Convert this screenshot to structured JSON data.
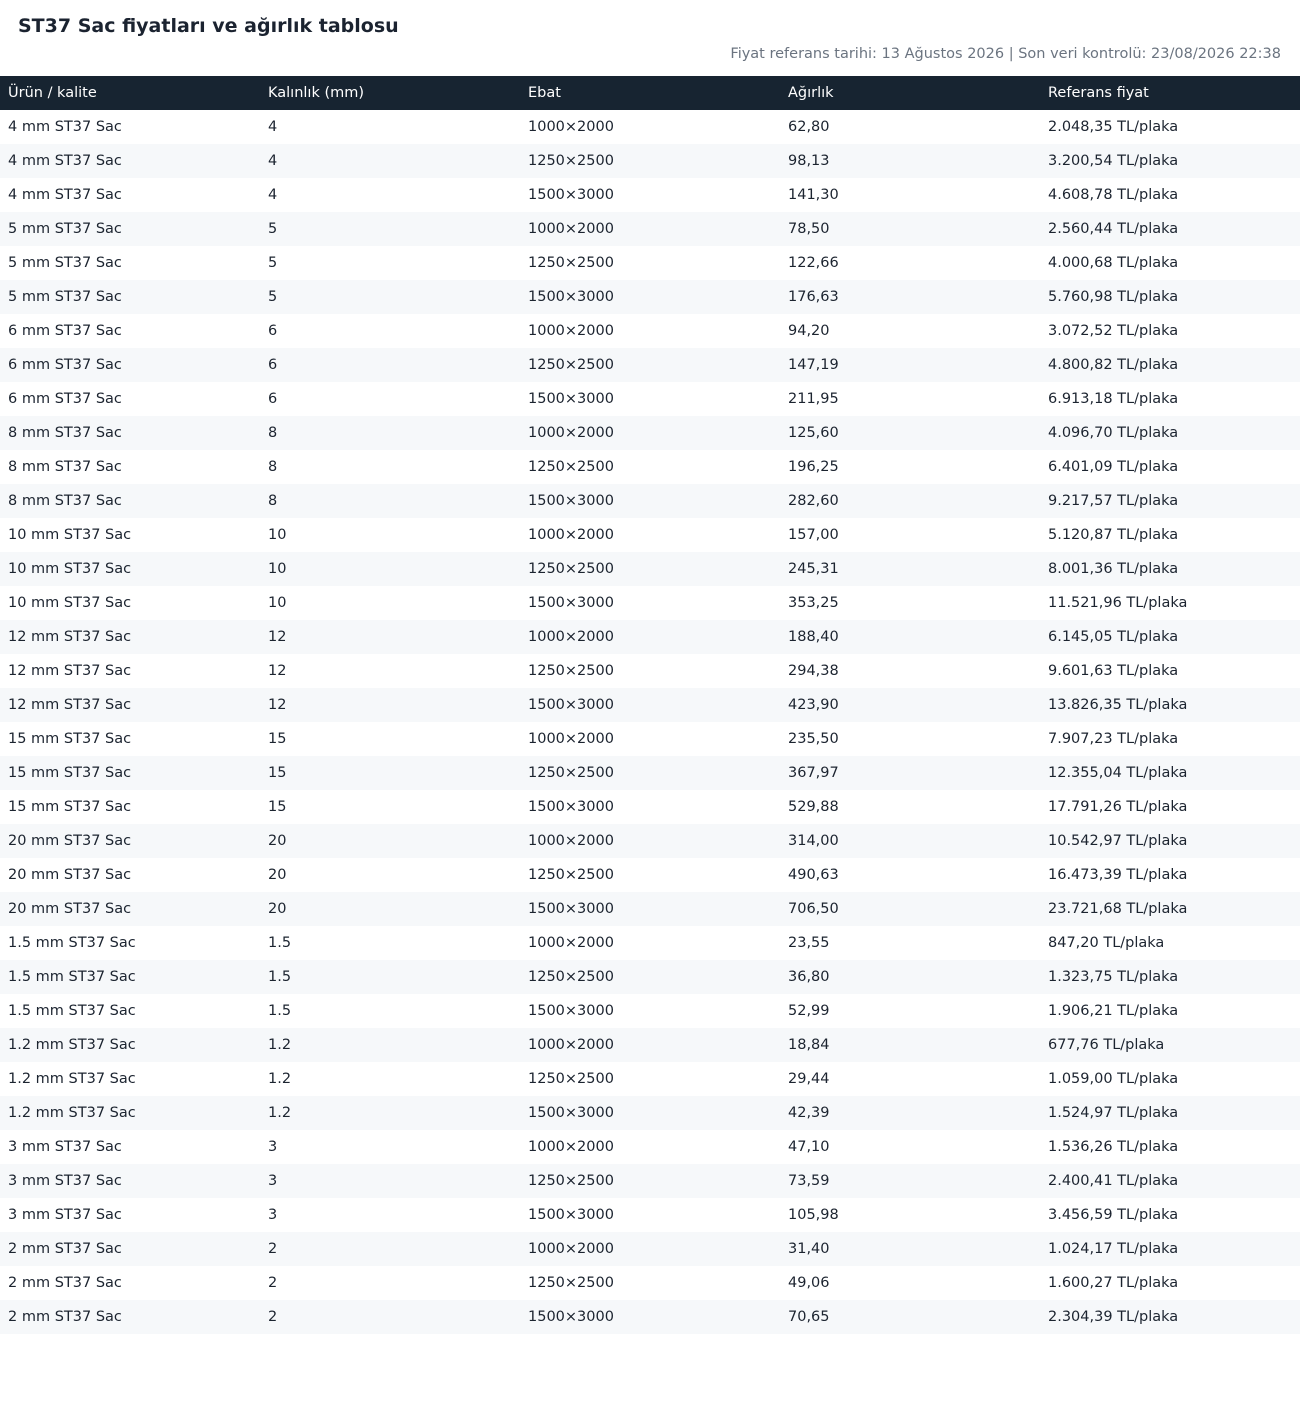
{
  "page": {
    "title": "ST37 Sac fiyatları ve ağırlık tablosu",
    "reference_line": "Fiyat referans tarihi: 13 Ağustos 2026 | Son veri kontrolü: 23/08/2026 22:38"
  },
  "table": {
    "headers": [
      "Ürün / kalite",
      "Kalınlık (mm)",
      "Ebat",
      "Ağırlık",
      "Referans fiyat"
    ],
    "rows": [
      [
        "4 mm ST37 Sac",
        "4",
        "1000×2000",
        "62,80",
        "2.048,35 TL/plaka"
      ],
      [
        "4 mm ST37 Sac",
        "4",
        "1250×2500",
        "98,13",
        "3.200,54 TL/plaka"
      ],
      [
        "4 mm ST37 Sac",
        "4",
        "1500×3000",
        "141,30",
        "4.608,78 TL/plaka"
      ],
      [
        "5 mm ST37 Sac",
        "5",
        "1000×2000",
        "78,50",
        "2.560,44 TL/plaka"
      ],
      [
        "5 mm ST37 Sac",
        "5",
        "1250×2500",
        "122,66",
        "4.000,68 TL/plaka"
      ],
      [
        "5 mm ST37 Sac",
        "5",
        "1500×3000",
        "176,63",
        "5.760,98 TL/plaka"
      ],
      [
        "6 mm ST37 Sac",
        "6",
        "1000×2000",
        "94,20",
        "3.072,52 TL/plaka"
      ],
      [
        "6 mm ST37 Sac",
        "6",
        "1250×2500",
        "147,19",
        "4.800,82 TL/plaka"
      ],
      [
        "6 mm ST37 Sac",
        "6",
        "1500×3000",
        "211,95",
        "6.913,18 TL/plaka"
      ],
      [
        "8 mm ST37 Sac",
        "8",
        "1000×2000",
        "125,60",
        "4.096,70 TL/plaka"
      ],
      [
        "8 mm ST37 Sac",
        "8",
        "1250×2500",
        "196,25",
        "6.401,09 TL/plaka"
      ],
      [
        "8 mm ST37 Sac",
        "8",
        "1500×3000",
        "282,60",
        "9.217,57 TL/plaka"
      ],
      [
        "10 mm ST37 Sac",
        "10",
        "1000×2000",
        "157,00",
        "5.120,87 TL/plaka"
      ],
      [
        "10 mm ST37 Sac",
        "10",
        "1250×2500",
        "245,31",
        "8.001,36 TL/plaka"
      ],
      [
        "10 mm ST37 Sac",
        "10",
        "1500×3000",
        "353,25",
        "11.521,96 TL/plaka"
      ],
      [
        "12 mm ST37 Sac",
        "12",
        "1000×2000",
        "188,40",
        "6.145,05 TL/plaka"
      ],
      [
        "12 mm ST37 Sac",
        "12",
        "1250×2500",
        "294,38",
        "9.601,63 TL/plaka"
      ],
      [
        "12 mm ST37 Sac",
        "12",
        "1500×3000",
        "423,90",
        "13.826,35 TL/plaka"
      ],
      [
        "15 mm ST37 Sac",
        "15",
        "1000×2000",
        "235,50",
        "7.907,23 TL/plaka"
      ],
      [
        "15 mm ST37 Sac",
        "15",
        "1250×2500",
        "367,97",
        "12.355,04 TL/plaka"
      ],
      [
        "15 mm ST37 Sac",
        "15",
        "1500×3000",
        "529,88",
        "17.791,26 TL/plaka"
      ],
      [
        "20 mm ST37 Sac",
        "20",
        "1000×2000",
        "314,00",
        "10.542,97 TL/plaka"
      ],
      [
        "20 mm ST37 Sac",
        "20",
        "1250×2500",
        "490,63",
        "16.473,39 TL/plaka"
      ],
      [
        "20 mm ST37 Sac",
        "20",
        "1500×3000",
        "706,50",
        "23.721,68 TL/plaka"
      ],
      [
        "1.5 mm ST37 Sac",
        "1.5",
        "1000×2000",
        "23,55",
        "847,20 TL/plaka"
      ],
      [
        "1.5 mm ST37 Sac",
        "1.5",
        "1250×2500",
        "36,80",
        "1.323,75 TL/plaka"
      ],
      [
        "1.5 mm ST37 Sac",
        "1.5",
        "1500×3000",
        "52,99",
        "1.906,21 TL/plaka"
      ],
      [
        "1.2 mm ST37 Sac",
        "1.2",
        "1000×2000",
        "18,84",
        "677,76 TL/plaka"
      ],
      [
        "1.2 mm ST37 Sac",
        "1.2",
        "1250×2500",
        "29,44",
        "1.059,00 TL/plaka"
      ],
      [
        "1.2 mm ST37 Sac",
        "1.2",
        "1500×3000",
        "42,39",
        "1.524,97 TL/plaka"
      ],
      [
        "3 mm ST37 Sac",
        "3",
        "1000×2000",
        "47,10",
        "1.536,26 TL/plaka"
      ],
      [
        "3 mm ST37 Sac",
        "3",
        "1250×2500",
        "73,59",
        "2.400,41 TL/plaka"
      ],
      [
        "3 mm ST37 Sac",
        "3",
        "1500×3000",
        "105,98",
        "3.456,59 TL/plaka"
      ],
      [
        "2 mm ST37 Sac",
        "2",
        "1000×2000",
        "31,40",
        "1.024,17 TL/plaka"
      ],
      [
        "2 mm ST37 Sac",
        "2",
        "1250×2500",
        "49,06",
        "1.600,27 TL/plaka"
      ],
      [
        "2 mm ST37 Sac",
        "2",
        "1500×3000",
        "70,65",
        "2.304,39 TL/plaka"
      ]
    ]
  },
  "colors": {
    "header_background": "#172431",
    "header_text": "#ffffff",
    "stripe_row": "#f6f8fa",
    "muted_text": "#6b7480"
  }
}
